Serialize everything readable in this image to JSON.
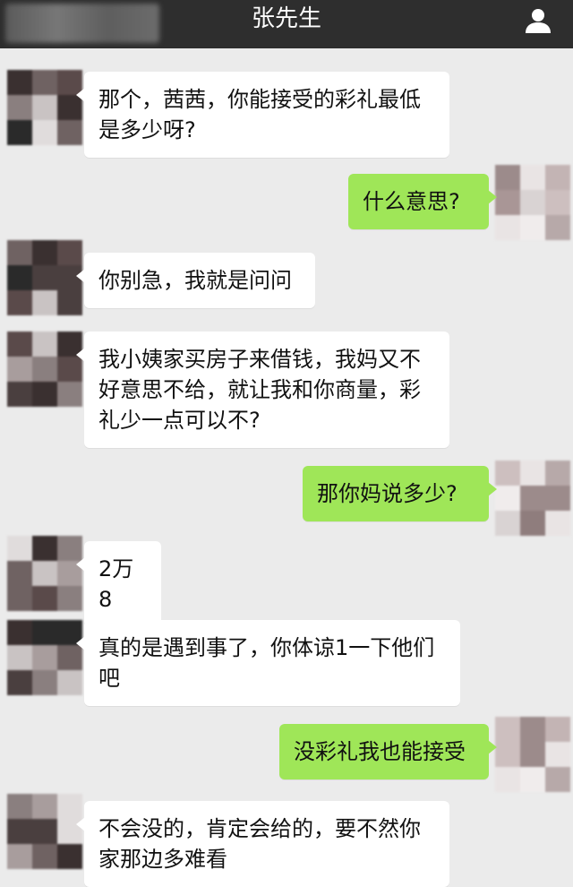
{
  "header": {
    "title": "张先生",
    "profile_icon": "person-icon"
  },
  "colors": {
    "topbar": "#2e2e2e",
    "background": "#ebebeb",
    "incoming_bubble": "#ffffff",
    "outgoing_bubble": "#9fe658"
  },
  "messages": [
    {
      "side": "left",
      "text": "那个，茜茜，你能接受的彩礼最低是多少呀?"
    },
    {
      "side": "right",
      "text": "什么意思?"
    },
    {
      "side": "left",
      "text": "你别急，我就是问问"
    },
    {
      "side": "left",
      "text": "我小姨家买房子来借钱，我妈又不好意思不给，就让我和你商量，彩礼少一点可以不?"
    },
    {
      "side": "right",
      "text": "那你妈说多少?"
    },
    {
      "side": "left",
      "text": "2万8"
    },
    {
      "side": "left",
      "text": "真的是遇到事了，你体谅1一下他们吧"
    },
    {
      "side": "right",
      "text": "没彩礼我也能接受"
    },
    {
      "side": "left",
      "text": "不会没的，肯定会给的，要不然你家那边多难看"
    }
  ]
}
